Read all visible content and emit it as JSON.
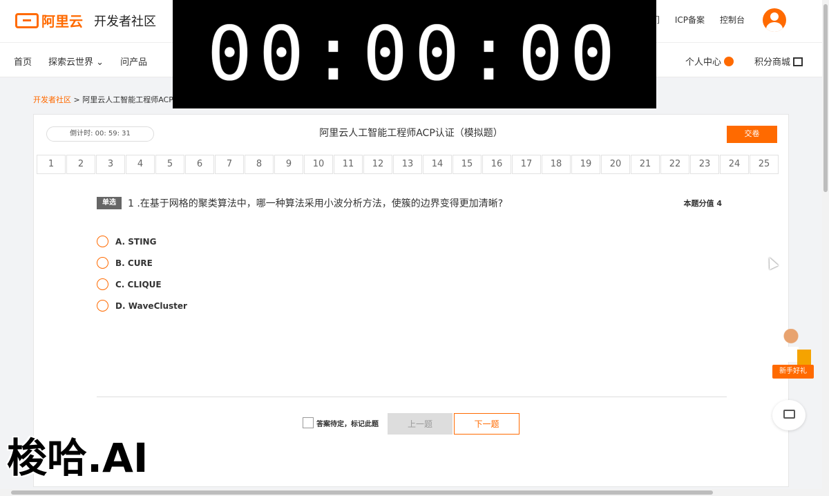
{
  "header": {
    "logo_text": "阿里云",
    "site_name": "开发者社区",
    "links": [
      "我们",
      "ICP备案",
      "控制台"
    ]
  },
  "nav": {
    "left_items": [
      "首页",
      "探索云世界",
      "问产品"
    ],
    "right_items": [
      "个人中心",
      "积分商城"
    ]
  },
  "breadcrumb": {
    "root": "开发者社区",
    "separator": ">",
    "current": "阿里云人工智能工程师ACP认证"
  },
  "timer_overlay": {
    "time": "00:00:00"
  },
  "exam": {
    "countdown_label": "倒计时:",
    "countdown_value": "00: 59: 31",
    "title": "阿里云人工智能工程师ACP认证（模拟题）",
    "submit_label": "交卷",
    "question_numbers": [
      "1",
      "2",
      "3",
      "4",
      "5",
      "6",
      "7",
      "8",
      "9",
      "10",
      "11",
      "12",
      "13",
      "14",
      "15",
      "16",
      "17",
      "18",
      "19",
      "20",
      "21",
      "22",
      "23",
      "24",
      "25"
    ],
    "question": {
      "type_badge": "单选",
      "text": "1 .在基于网格的聚类算法中，哪一种算法采用小波分析方法，使簇的边界变得更加清晰?",
      "score_label": "本题分值",
      "score_value": "4",
      "options": [
        "A. STING",
        "B. CURE",
        "C. CLIQUE",
        "D. WaveCluster"
      ]
    },
    "mark_label": "答案待定，标记此题",
    "prev_label": "上一题",
    "next_label": "下一题"
  },
  "widgets": {
    "gift_label": "新手好礼"
  },
  "watermark": "梭哈.AI",
  "colors": {
    "accent": "#ff6a00",
    "overlay": "#000000"
  }
}
